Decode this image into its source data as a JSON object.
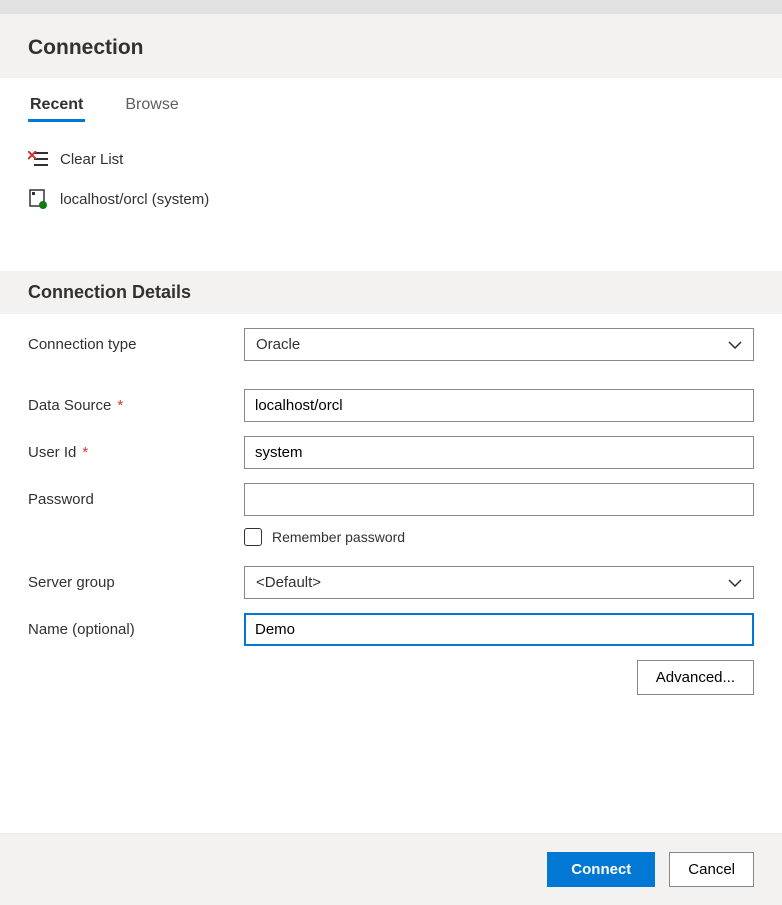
{
  "header": {
    "title": "Connection"
  },
  "tabs": {
    "recent": "Recent",
    "browse": "Browse",
    "active": "recent"
  },
  "recent": {
    "clear_list": "Clear List",
    "items": [
      {
        "label": "localhost/orcl (system)"
      }
    ]
  },
  "details": {
    "section_title": "Connection Details",
    "labels": {
      "connection_type": "Connection type",
      "data_source": "Data Source",
      "user_id": "User Id",
      "password": "Password",
      "remember": "Remember password",
      "server_group": "Server group",
      "name": "Name (optional)"
    },
    "values": {
      "connection_type": "Oracle",
      "data_source": "localhost/orcl",
      "user_id": "system",
      "password": "",
      "remember": false,
      "server_group": "<Default>",
      "name": "Demo"
    },
    "required_marker": "*"
  },
  "buttons": {
    "advanced": "Advanced...",
    "connect": "Connect",
    "cancel": "Cancel"
  }
}
